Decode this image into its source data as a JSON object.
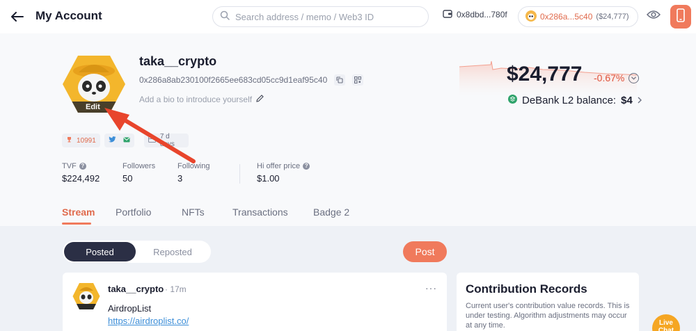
{
  "header": {
    "title": "My Account",
    "search_placeholder": "Search address / memo / Web3 ID",
    "wallet_short": "0x8dbd...780f",
    "account_short": "0x286a...5c40",
    "account_value": "($24,777)"
  },
  "profile": {
    "username": "taka__crypto",
    "address": "0x286a8ab230100f2665ee683cd05cc9d1eaf95c40",
    "bio_placeholder": "Add a bio to introduce yourself",
    "avatar_edit": "Edit",
    "badges": {
      "score": "10991",
      "days": "7 d days"
    }
  },
  "stats": [
    {
      "label": "TVF",
      "value": "$224,492"
    },
    {
      "label": "Followers",
      "value": "50"
    },
    {
      "label": "Following",
      "value": "3"
    },
    {
      "label": "Hi offer price",
      "value": "$1.00"
    }
  ],
  "balance": {
    "total": "$24,777",
    "change": "-0.67%",
    "l2_label": "DeBank L2 balance:",
    "l2_value": "$4"
  },
  "tabs": [
    "Stream",
    "Portfolio",
    "NFTs",
    "Transactions",
    "Badge 2"
  ],
  "feed": {
    "seg_posted": "Posted",
    "seg_reposted": "Reposted",
    "post_button": "Post",
    "card": {
      "name": "taka__crypto",
      "time": "· 17m",
      "more": "···",
      "text": "AirdropList",
      "link": "https://airdroplist.co/"
    }
  },
  "contribution": {
    "title": "Contribution Records",
    "desc": "Current user's contribution value records. This is under testing. Algorithm adjustments may occur at any time."
  },
  "live_chat": "Live Chat",
  "colors": {
    "accent": "#f07a5c",
    "negative": "#e0533b",
    "dark_pill": "#2b2f45",
    "link": "#3c8ed8",
    "annotation_arrow": "#e8452c"
  }
}
